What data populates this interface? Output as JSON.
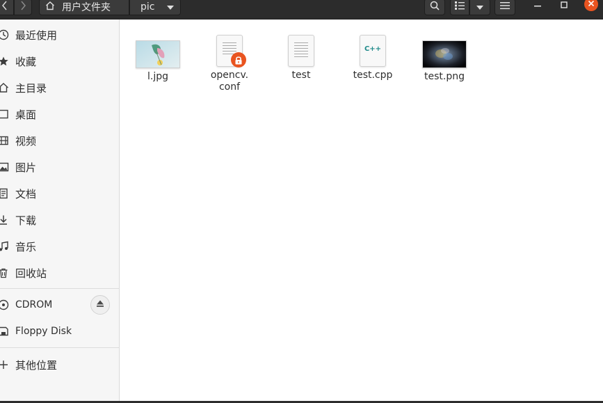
{
  "header": {
    "breadcrumbs": [
      {
        "label": "用户文件夹"
      },
      {
        "label": "pic"
      }
    ]
  },
  "sidebar": {
    "items": [
      {
        "label": "最近使用",
        "icon": "clock-icon"
      },
      {
        "label": "收藏",
        "icon": "star-icon"
      },
      {
        "label": "主目录",
        "icon": "home-icon"
      },
      {
        "label": "桌面",
        "icon": "desktop-icon"
      },
      {
        "label": "视频",
        "icon": "video-icon"
      },
      {
        "label": "图片",
        "icon": "picture-icon"
      },
      {
        "label": "文档",
        "icon": "document-icon"
      },
      {
        "label": "下载",
        "icon": "download-icon"
      },
      {
        "label": "音乐",
        "icon": "music-icon"
      },
      {
        "label": "回收站",
        "icon": "trash-icon"
      }
    ],
    "devices": [
      {
        "label": "CDROM",
        "icon": "disc-icon"
      },
      {
        "label": "Floppy Disk",
        "icon": "floppy-icon"
      }
    ],
    "other": {
      "label": "其他位置",
      "icon": "plus-icon"
    }
  },
  "files": [
    {
      "name": "l.jpg",
      "type": "image"
    },
    {
      "name": "opencv.\nconf",
      "type": "locked-text"
    },
    {
      "name": "test",
      "type": "text"
    },
    {
      "name": "test.cpp",
      "type": "cpp"
    },
    {
      "name": "test.png",
      "type": "image-dark"
    }
  ],
  "colors": {
    "accent": "#e95420",
    "headerbar": "#2c2c2c",
    "sidebar": "#f6f6f6"
  }
}
